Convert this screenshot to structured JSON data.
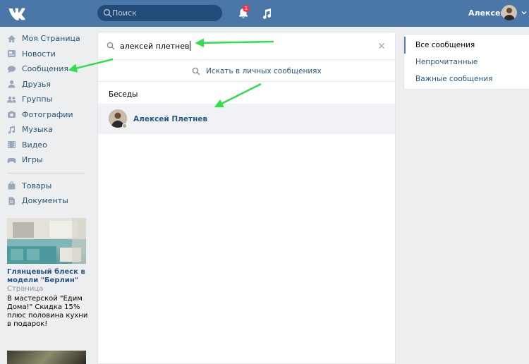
{
  "header": {
    "search_placeholder": "Поиск",
    "notifications_count": "1",
    "user_name": "Алексей",
    "brand_color": "#4a76a8"
  },
  "nav": {
    "items": [
      {
        "label": "Моя Страница",
        "icon": "home-icon"
      },
      {
        "label": "Новости",
        "icon": "news-icon"
      },
      {
        "label": "Сообщения",
        "icon": "messages-icon"
      },
      {
        "label": "Друзья",
        "icon": "friends-icon"
      },
      {
        "label": "Группы",
        "icon": "groups-icon"
      },
      {
        "label": "Фотографии",
        "icon": "camera-icon"
      },
      {
        "label": "Музыка",
        "icon": "music-note-icon"
      },
      {
        "label": "Видео",
        "icon": "video-icon"
      },
      {
        "label": "Игры",
        "icon": "games-icon"
      }
    ],
    "items2": [
      {
        "label": "Товары",
        "icon": "shopping-bag-icon"
      },
      {
        "label": "Документы",
        "icon": "document-icon"
      }
    ]
  },
  "ad": {
    "title": "Глянцевый блеск в модели \"Берлин\"",
    "subtitle": "Страница",
    "text": "В мастерской \"Едим Дома!\" Скидка 15% плюс половина кухни в подарок!"
  },
  "messages": {
    "search_value": "алексей плетнев",
    "search_in_label": "Искать в личных сообщениях",
    "section_title": "Беседы",
    "result_name": "Алексей Плетнев"
  },
  "filters": {
    "items": [
      "Все сообщения",
      "Непрочитанные",
      "Важные сообщения"
    ],
    "active": "Все сообщения"
  },
  "annotation_arrow_color": "#2ee04a"
}
